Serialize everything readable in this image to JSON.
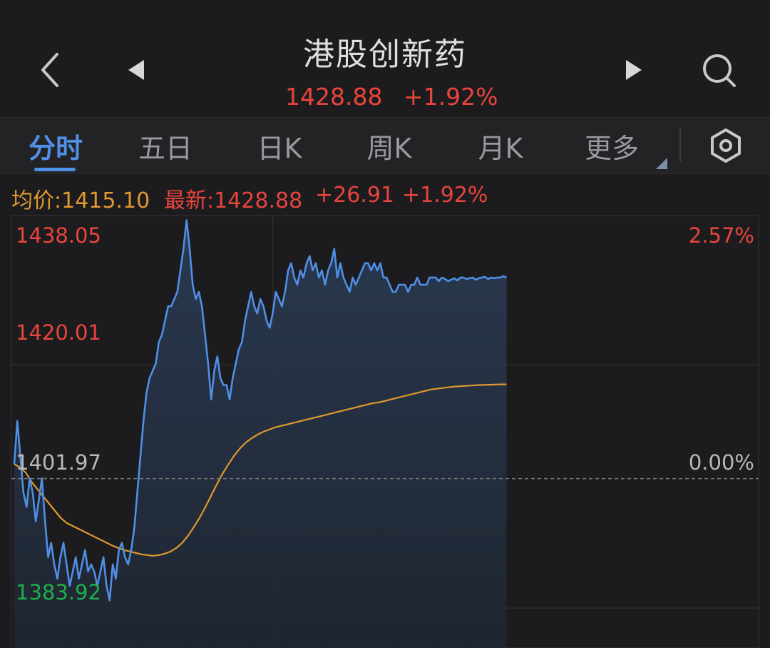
{
  "header": {
    "title": "港股创新药",
    "price": "1428.88",
    "change_pct": "+1.92%",
    "icons": [
      "back-chevron-icon",
      "prev-triangle-icon",
      "next-triangle-icon",
      "search-icon"
    ]
  },
  "tabs": {
    "items": [
      {
        "label": "分时",
        "active": true
      },
      {
        "label": "五日"
      },
      {
        "label": "日K"
      },
      {
        "label": "周K"
      },
      {
        "label": "月K"
      },
      {
        "label": "更多"
      }
    ],
    "settings_icon": "gear-hexagon-icon"
  },
  "info": {
    "avg_label": "均价:1415.10",
    "latest_label": "最新:1428.88",
    "change": "+26.91",
    "change_pct": "+1.92%"
  },
  "colors": {
    "up": "#e8453c",
    "down": "#1fae4b",
    "avg_text": "#e0982f",
    "price_line": "#4f8fe6",
    "avg_line": "#e0982f",
    "background": "#1c1c1f"
  },
  "chart_data": {
    "type": "line",
    "prev_close": 1401.97,
    "ylim": [
      1383.92,
      1438.05
    ],
    "y_labels_left": [
      "1438.05",
      "1420.01",
      "1401.97",
      "1383.92"
    ],
    "y_labels_right": [
      "2.57%",
      "0.00%"
    ],
    "x_slots": 242,
    "series": [
      {
        "values": [
          1404,
          1410,
          1405,
          1400,
          1398,
          1402,
          1400,
          1396,
          1399,
          1402,
          1396,
          1391,
          1393,
          1390,
          1388,
          1391,
          1393,
          1390,
          1387,
          1389,
          1391,
          1388,
          1390,
          1392,
          1389,
          1390,
          1389,
          1387,
          1389,
          1391,
          1387,
          1385,
          1390,
          1388,
          1392,
          1393,
          1391,
          1390,
          1392,
          1395,
          1400,
          1405,
          1410,
          1414,
          1416,
          1417,
          1418,
          1421,
          1422,
          1424,
          1426,
          1426,
          1427,
          1428,
          1431,
          1434,
          1438,
          1434,
          1429,
          1427,
          1428,
          1426,
          1422,
          1418,
          1413,
          1417,
          1419,
          1416,
          1415,
          1415,
          1413,
          1416,
          1418,
          1420,
          1421,
          1424,
          1426,
          1428,
          1426,
          1425,
          1427,
          1426,
          1424,
          1423,
          1425,
          1428,
          1427,
          1426,
          1428,
          1431,
          1432,
          1430,
          1429,
          1431,
          1430,
          1432,
          1433,
          1431,
          1432,
          1430,
          1431,
          1429,
          1431,
          1432,
          1434,
          1430,
          1432,
          1430,
          1429,
          1428,
          1430,
          1429,
          1430,
          1431,
          1432,
          1432,
          1431,
          1432,
          1431,
          1432,
          1430,
          1430,
          1429,
          1428,
          1428,
          1429,
          1429,
          1429,
          1428,
          1429,
          1429,
          1430,
          1429,
          1429,
          1429,
          1430,
          1430,
          1430,
          1429.5,
          1430,
          1429.8,
          1429.5,
          1429.7,
          1429.9,
          1429.6,
          1430,
          1430,
          1429.8,
          1429.9,
          1430,
          1429.7,
          1429.9,
          1430,
          1430.1,
          1429.8,
          1430,
          1429.9,
          1430,
          1430,
          1430.2,
          1430
        ],
        "color_key": "price_line"
      },
      {
        "values": [
          1404,
          1403.5,
          1402.8,
          1401.5,
          1400.5,
          1399.5,
          1398.5,
          1397.5,
          1396.5,
          1395.8,
          1395.4,
          1395,
          1394.6,
          1394.2,
          1393.8,
          1393.4,
          1393,
          1392.6,
          1392.3,
          1392,
          1391.8,
          1391.6,
          1391.4,
          1391.3,
          1391.2,
          1391.3,
          1391.5,
          1391.8,
          1392.3,
          1393,
          1394,
          1395.2,
          1396.5,
          1398,
          1399.6,
          1401.2,
          1402.7,
          1404,
          1405.2,
          1406.2,
          1407,
          1407.6,
          1408.1,
          1408.5,
          1408.8,
          1409.1,
          1409.3,
          1409.5,
          1409.7,
          1409.9,
          1410.1,
          1410.3,
          1410.5,
          1410.7,
          1410.9,
          1411.1,
          1411.3,
          1411.5,
          1411.7,
          1411.9,
          1412.1,
          1412.3,
          1412.5,
          1412.6,
          1412.8,
          1413,
          1413.2,
          1413.4,
          1413.6,
          1413.8,
          1414,
          1414.2,
          1414.4,
          1414.5,
          1414.6,
          1414.7,
          1414.8,
          1414.85,
          1414.9,
          1414.95,
          1415,
          1415.02,
          1415.05,
          1415.07,
          1415.1,
          1415.1
        ],
        "color_key": "avg_line"
      }
    ]
  }
}
